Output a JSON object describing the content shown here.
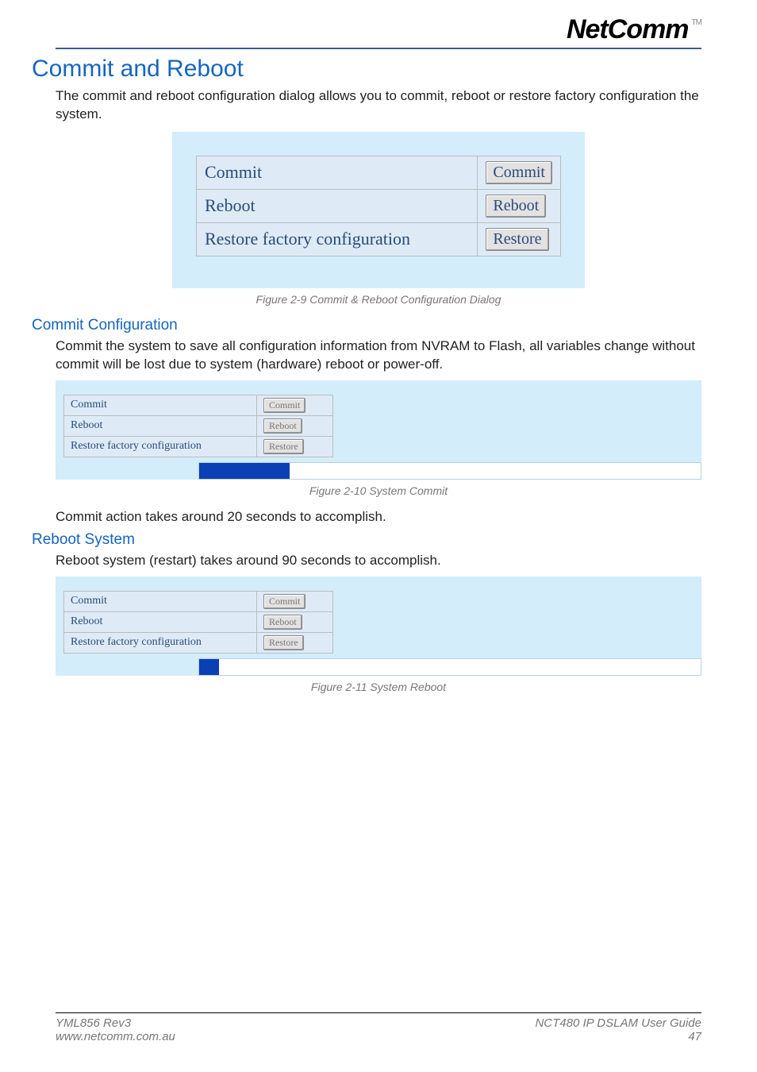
{
  "brand": {
    "name": "NetComm",
    "tm": "TM"
  },
  "title": "Commit and Reboot",
  "intro": "The commit and reboot configuration dialog allows you to commit, reboot or restore factory configuration the system.",
  "dialog1": {
    "rows": [
      {
        "label": "Commit",
        "button": "Commit"
      },
      {
        "label": "Reboot",
        "button": "Reboot"
      },
      {
        "label": "Restore factory configuration",
        "button": "Restore"
      }
    ],
    "caption": "Figure 2-9 Commit & Reboot Configuration Dialog"
  },
  "section2": {
    "heading": "Commit Configuration",
    "text": "Commit the system to save all configuration information from NVRAM to Flash, all variables change without commit will be lost due to system (hardware) reboot or power-off.",
    "rows": [
      {
        "label": "Commit",
        "button": "Commit"
      },
      {
        "label": "Reboot",
        "button": "Reboot"
      },
      {
        "label": "Restore factory configuration",
        "button": "Restore"
      }
    ],
    "progress_pct": 18,
    "caption": "Figure 2-10 System Commit",
    "note": "Commit action takes around 20 seconds to accomplish."
  },
  "section3": {
    "heading": "Reboot System",
    "text": "Reboot system (restart) takes around 90 seconds to accomplish.",
    "rows": [
      {
        "label": "Commit",
        "button": "Commit"
      },
      {
        "label": "Reboot",
        "button": "Reboot"
      },
      {
        "label": "Restore factory configuration",
        "button": "Restore"
      }
    ],
    "progress_pct": 4,
    "caption": "Figure 2-11 System Reboot"
  },
  "footer": {
    "left1": "YML856 Rev3",
    "left2": "www.netcomm.com.au",
    "right1": "NCT480 IP DSLAM User Guide",
    "right2": "47"
  }
}
